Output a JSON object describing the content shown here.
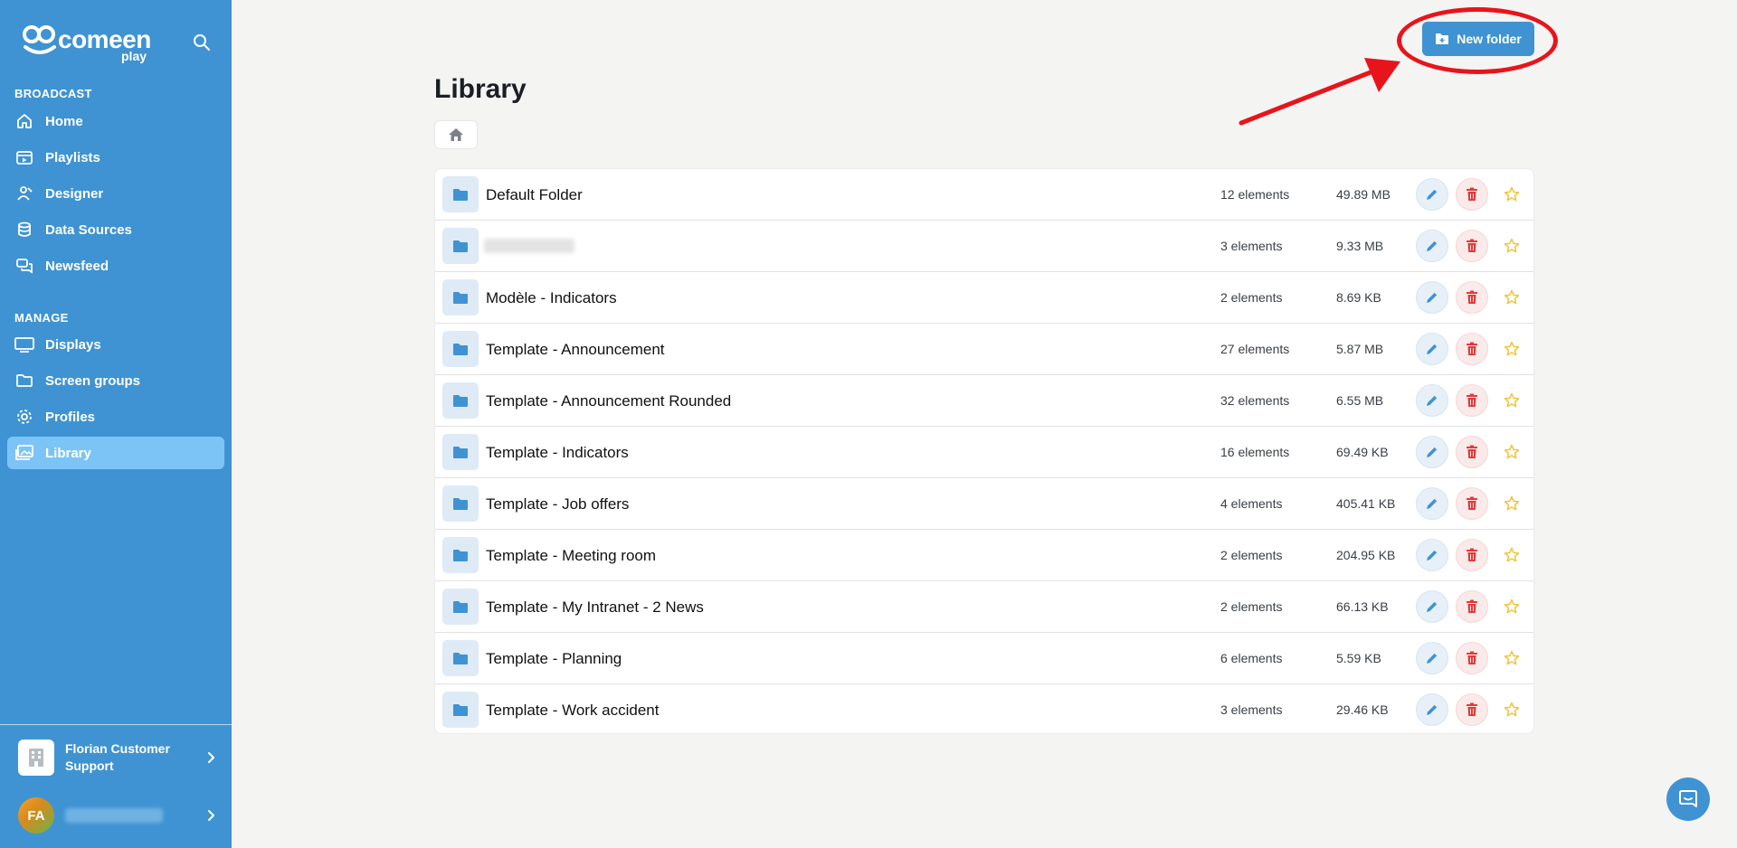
{
  "brand": {
    "logo_text": "comeen",
    "logo_sub": "play",
    "color_primary": "#3f93d2",
    "color_active": "#7cc4f6"
  },
  "sidebar": {
    "sections": [
      {
        "label": "BROADCAST",
        "items": [
          {
            "label": "Home",
            "icon": "home-icon"
          },
          {
            "label": "Playlists",
            "icon": "playlist-icon"
          },
          {
            "label": "Designer",
            "icon": "designer-icon"
          },
          {
            "label": "Data Sources",
            "icon": "database-icon"
          },
          {
            "label": "Newsfeed",
            "icon": "newsfeed-icon"
          }
        ]
      },
      {
        "label": "MANAGE",
        "items": [
          {
            "label": "Displays",
            "icon": "monitor-icon"
          },
          {
            "label": "Screen groups",
            "icon": "folder-outline-icon"
          },
          {
            "label": "Profiles",
            "icon": "gear-icon"
          },
          {
            "label": "Library",
            "icon": "library-icon",
            "active": true
          }
        ]
      }
    ],
    "organization": {
      "name": "Florian Customer Support",
      "icon": "building-icon"
    },
    "user": {
      "initials": "FA"
    }
  },
  "header": {
    "new_folder_label": "New folder"
  },
  "page": {
    "title": "Library"
  },
  "folders": [
    {
      "name": "Default Folder",
      "count": "12 elements",
      "size": "49.89 MB"
    },
    {
      "name": "",
      "count": "3 elements",
      "size": "9.33 MB",
      "blurred": true
    },
    {
      "name": "Modèle - Indicators",
      "count": "2 elements",
      "size": "8.69 KB"
    },
    {
      "name": "Template - Announcement",
      "count": "27 elements",
      "size": "5.87 MB"
    },
    {
      "name": "Template - Announcement Rounded",
      "count": "32 elements",
      "size": "6.55 MB"
    },
    {
      "name": "Template - Indicators",
      "count": "16 elements",
      "size": "69.49 KB"
    },
    {
      "name": "Template - Job offers",
      "count": "4 elements",
      "size": "405.41 KB"
    },
    {
      "name": "Template - Meeting room",
      "count": "2 elements",
      "size": "204.95 KB"
    },
    {
      "name": "Template - My Intranet - 2 News",
      "count": "2 elements",
      "size": "66.13 KB"
    },
    {
      "name": "Template - Planning",
      "count": "6 elements",
      "size": "5.59 KB"
    },
    {
      "name": "Template - Work accident",
      "count": "3 elements",
      "size": "29.46 KB"
    }
  ],
  "annotation": {
    "color": "#e8141b"
  }
}
